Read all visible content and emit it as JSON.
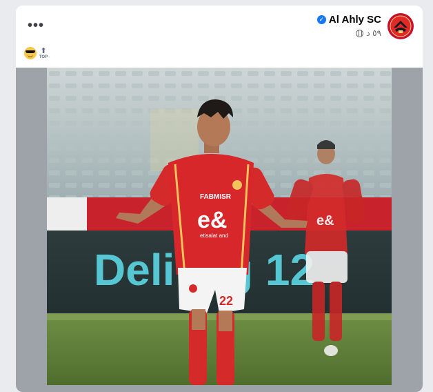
{
  "post": {
    "page_name": "Al Ahly SC",
    "timestamp": "٥٩ د",
    "more_label": "•••",
    "text_emojis": [
      "😎",
      "🔝"
    ],
    "top_label": "TOP"
  },
  "photo": {
    "board_text": "Deli ing 12",
    "sponsor_primary": "e&",
    "sponsor_secondary": "etisalat and",
    "sponsor_top": "FABMISR",
    "shorts_number": "22"
  },
  "colors": {
    "brand_red": "#d71920",
    "verified_blue": "#1877f2",
    "board_cyan": "#5fe0ee"
  }
}
